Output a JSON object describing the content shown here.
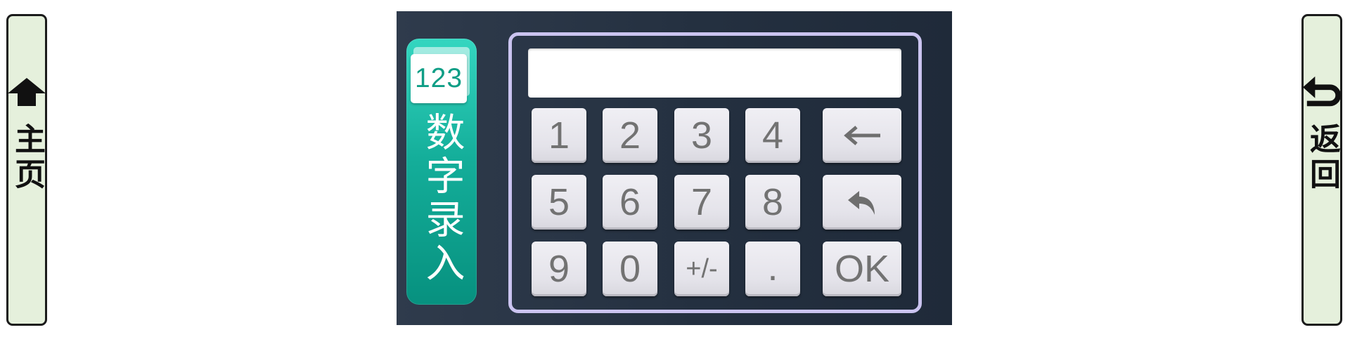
{
  "nav": {
    "home": {
      "label": "主页",
      "icon": "up-arrow-icon"
    },
    "back": {
      "label": "返回",
      "icon": "return-arrow-icon"
    }
  },
  "mode": {
    "icon_text": "123",
    "title": "数字录入"
  },
  "display": {
    "value": ""
  },
  "keypad": {
    "keys": [
      "1",
      "2",
      "3",
      "4",
      "5",
      "6",
      "7",
      "8",
      "9",
      "0",
      "+/-",
      "."
    ],
    "backspace_icon": "left-arrow-icon",
    "undo_icon": "undo-arrow-icon",
    "ok_label": "OK"
  },
  "colors": {
    "panel_bg": "#243040",
    "mode_tag": "#14ae9a",
    "frame_border": "#cbc4f0",
    "key_bg": "#e8e7ed",
    "side_button_bg": "#e5f0dc"
  }
}
